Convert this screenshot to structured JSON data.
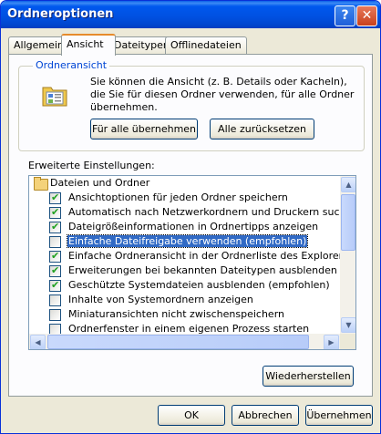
{
  "window": {
    "title": "Ordneroptionen"
  },
  "titlebar": {
    "help_icon": "?",
    "close_icon": "✕"
  },
  "tabs": [
    "Allgemein",
    "Ansicht",
    "Dateitypen",
    "Offlinedateien"
  ],
  "active_tab": "Ansicht",
  "folder_view": {
    "title": "Ordneransicht",
    "description": "Sie können die Ansicht (z. B. Details oder Kacheln), die Sie für diesen Ordner verwenden, für alle Ordner übernehmen.",
    "apply_all_label": "Für alle übernehmen",
    "reset_all_label": "Alle zurücksetzen"
  },
  "advanced": {
    "label": "Erweiterte Einstellungen:",
    "items": [
      {
        "label": "Dateien und Ordner",
        "type": "folder"
      },
      {
        "label": "Ansichtoptionen für jeden Ordner speichern",
        "checked": true
      },
      {
        "label": "Automatisch nach Netzwerkordnern und Druckern suchen",
        "checked": true
      },
      {
        "label": "Dateigrößeinformationen in Ordnertipps anzeigen",
        "checked": true
      },
      {
        "label": "Einfache Dateifreigabe verwenden (empfohlen)",
        "checked": false,
        "selected": true
      },
      {
        "label": "Einfache Ordneransicht in der Ordnerliste des Explorers anzeigen",
        "checked": true
      },
      {
        "label": "Erweiterungen bei bekannten Dateitypen ausblenden",
        "checked": true
      },
      {
        "label": "Geschützte Systemdateien ausblenden (empfohlen)",
        "checked": true
      },
      {
        "label": "Inhalte von Systemordnern anzeigen",
        "checked": false
      },
      {
        "label": "Miniaturansichten nicht zwischenspeichern",
        "checked": false
      },
      {
        "label": "Ordnerfenster in einem eigenen Prozess starten",
        "checked": false
      }
    ],
    "restore_label": "Wiederherstellen"
  },
  "footer": {
    "ok_label": "OK",
    "cancel_label": "Abbrechen",
    "apply_label": "Übernehmen"
  },
  "icons": {
    "check": "✔",
    "scroll_up": "▲",
    "scroll_down": "▼",
    "scroll_left": "◀",
    "scroll_right": "▶"
  }
}
